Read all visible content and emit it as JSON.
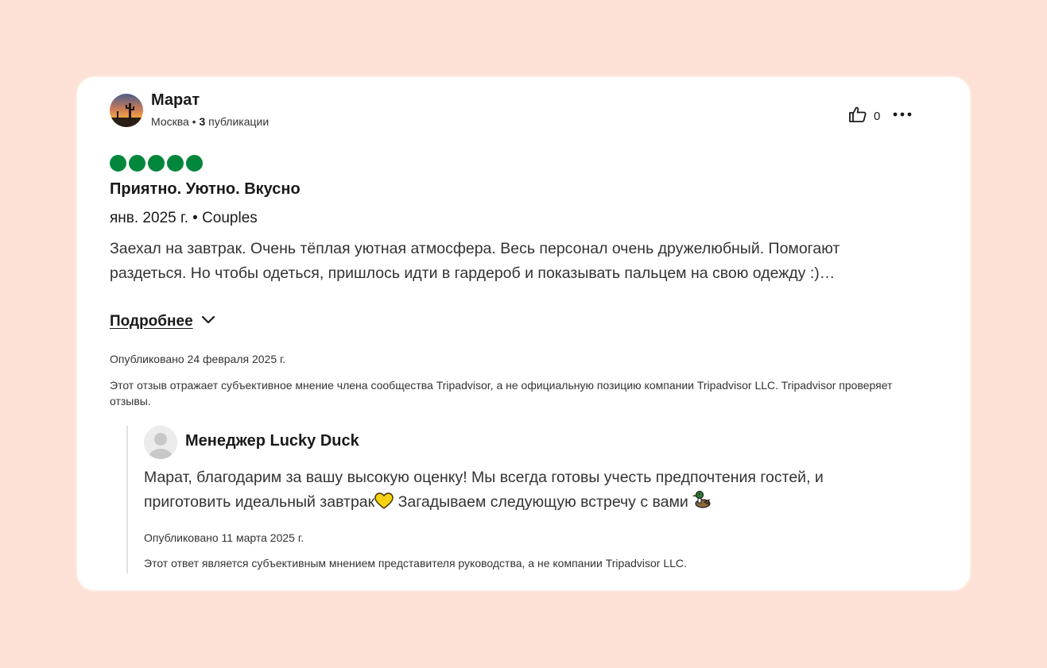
{
  "review": {
    "author": {
      "name": "Марат",
      "location": "Москва",
      "separator": " • ",
      "posts_count": "3",
      "posts_label": " публикации"
    },
    "helpful_count": "0",
    "rating": 5,
    "title": "Приятно. Уютно. Вкусно",
    "trip_meta": "янв. 2025 г. • Couples",
    "text": "Заехал на завтрак. Очень тёплая уютная атмосфера. Весь персонал очень дружелюбный. Помогают раздеться. Но чтобы одеться, пришлось идти в гардероб и показывать пальцем на свою одежду :)…",
    "read_more_label": "Подробнее",
    "published": "Опубликовано 24 февраля 2025 г.",
    "disclaimer": "Этот отзыв отражает субъективное мнение члена сообщества Tripadvisor, а не официальную позицию компании Tripadvisor LLC. Tripadvisor проверяет отзывы."
  },
  "response": {
    "author": "Менеджер Lucky Duck",
    "text_part1": "Марат, благодарим за вашу высокую оценку! Мы всегда готовы учесть предпочтения гостей, и приготовить идеальный завтрак",
    "text_part2": " Загадываем следующую встречу с вами ",
    "published": "Опубликовано 11 марта 2025 г.",
    "disclaimer": "Этот ответ является субъективным мнением представителя руководства, а не компании Tripadvisor LLC."
  },
  "colors": {
    "background": "#fde1d6",
    "rating_green": "#00873c",
    "text_dark": "#1a1a1a"
  },
  "icons": {
    "helpful": "thumbs-up-icon",
    "more": "more-dots-icon",
    "expand": "chevron-down-icon",
    "heart": "yellow-heart-icon",
    "duck": "duck-icon"
  }
}
